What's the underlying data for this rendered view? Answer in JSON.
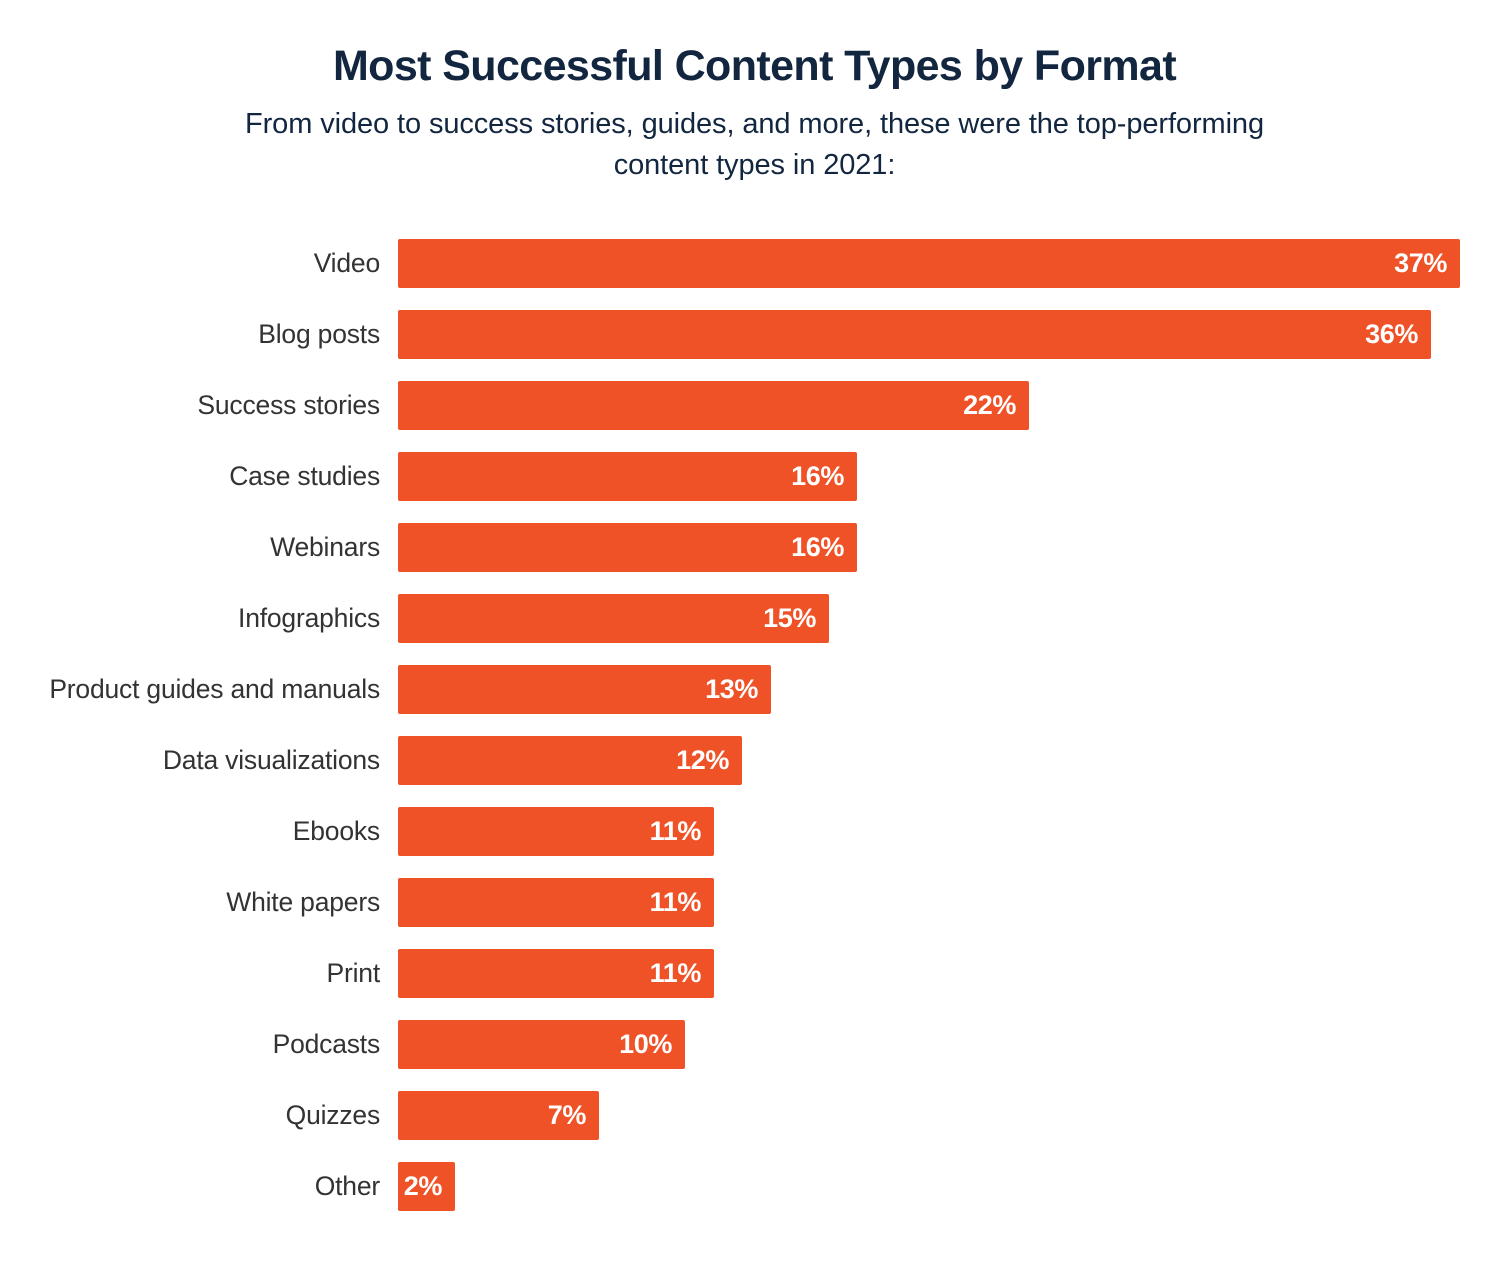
{
  "header": {
    "title": "Most Successful Content Types by Format",
    "subtitle": "From video to success stories, guides, and more, these were the top-performing content types in 2021:"
  },
  "colors": {
    "bar": "#EF5227",
    "title": "#12263F",
    "category_label": "#333333",
    "value_label": "#FFFFFF",
    "background": "#FFFFFF"
  },
  "chart_data": {
    "type": "bar",
    "orientation": "horizontal",
    "title": "Most Successful Content Types by Format",
    "subtitle": "From video to success stories, guides, and more, these were the top-performing content types in 2021:",
    "xlabel": "",
    "ylabel": "",
    "xlim": [
      0,
      37
    ],
    "grid": false,
    "legend": false,
    "value_suffix": "%",
    "categories": [
      "Video",
      "Blog posts",
      "Success stories",
      "Case studies",
      "Webinars",
      "Infographics",
      "Product guides and manuals",
      "Data visualizations",
      "Ebooks",
      "White papers",
      "Print",
      "Podcasts",
      "Quizzes",
      "Other"
    ],
    "values": [
      37,
      36,
      22,
      16,
      16,
      15,
      13,
      12,
      11,
      11,
      11,
      10,
      7,
      2
    ],
    "value_labels": [
      "37%",
      "36%",
      "22%",
      "16%",
      "16%",
      "15%",
      "13%",
      "12%",
      "11%",
      "11%",
      "11%",
      "10%",
      "7%",
      "2%"
    ],
    "bars": [
      {
        "category": "Video",
        "value": 37,
        "label": "37%"
      },
      {
        "category": "Blog posts",
        "value": 36,
        "label": "36%"
      },
      {
        "category": "Success stories",
        "value": 22,
        "label": "22%"
      },
      {
        "category": "Case studies",
        "value": 16,
        "label": "16%"
      },
      {
        "category": "Webinars",
        "value": 16,
        "label": "16%"
      },
      {
        "category": "Infographics",
        "value": 15,
        "label": "15%"
      },
      {
        "category": "Product guides and manuals",
        "value": 13,
        "label": "13%"
      },
      {
        "category": "Data visualizations",
        "value": 12,
        "label": "12%"
      },
      {
        "category": "Ebooks",
        "value": 11,
        "label": "11%"
      },
      {
        "category": "White papers",
        "value": 11,
        "label": "11%"
      },
      {
        "category": "Print",
        "value": 11,
        "label": "11%"
      },
      {
        "category": "Podcasts",
        "value": 10,
        "label": "10%"
      },
      {
        "category": "Quizzes",
        "value": 7,
        "label": "7%"
      },
      {
        "category": "Other",
        "value": 2,
        "label": "2%"
      }
    ]
  }
}
